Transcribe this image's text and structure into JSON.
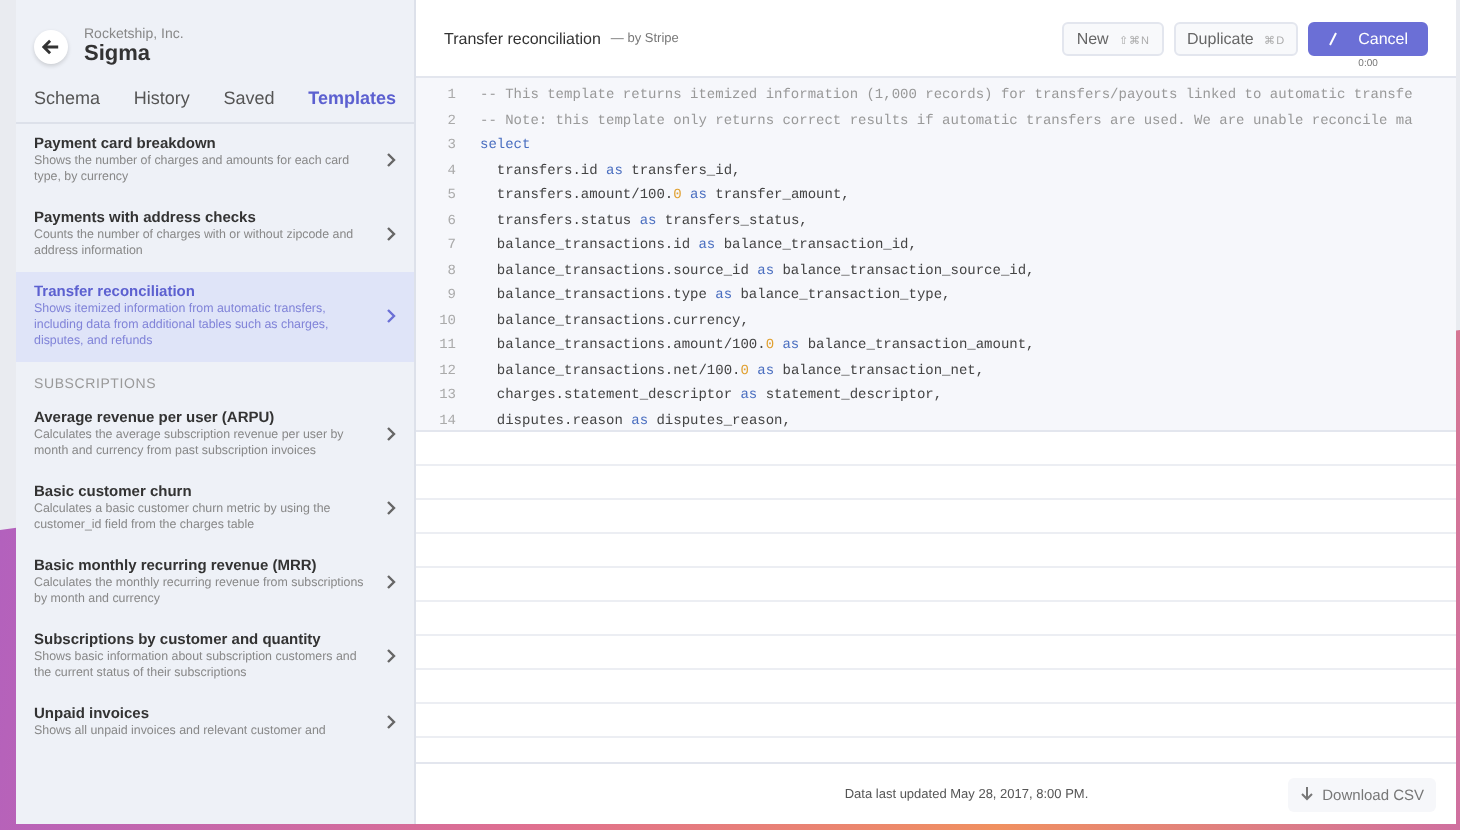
{
  "sidebar": {
    "account": "Rocketship, Inc.",
    "app_title": "Sigma",
    "tabs": [
      {
        "label": "Schema",
        "selected": false
      },
      {
        "label": "History",
        "selected": false
      },
      {
        "label": "Saved",
        "selected": false
      },
      {
        "label": "Templates",
        "selected": true
      }
    ],
    "groups": [
      {
        "items": [
          {
            "title": "Payment card breakdown",
            "description": "Shows the number of charges and amounts for each card type, by currency",
            "selected": false
          },
          {
            "title": "Payments with address checks",
            "description": "Counts the number of charges with or without zipcode and address information",
            "selected": false
          },
          {
            "title": "Transfer reconciliation",
            "description": "Shows itemized information from automatic transfers, including data from additional tables such as charges, disputes, and refunds",
            "selected": true
          }
        ]
      },
      {
        "heading": "SUBSCRIPTIONS",
        "items": [
          {
            "title": "Average revenue per user (ARPU)",
            "description": "Calculates the average subscription revenue per user by month and currency from past subscription invoices",
            "selected": false
          },
          {
            "title": "Basic customer churn",
            "description": "Calculates a basic customer churn metric by using the customer_id field from the charges table",
            "selected": false
          },
          {
            "title": "Basic monthly recurring revenue (MRR)",
            "description": "Calculates the monthly recurring revenue from subscriptions by month and currency",
            "selected": false
          },
          {
            "title": "Subscriptions by customer and quantity",
            "description": "Shows basic information about subscription customers and the current status of their subscriptions",
            "selected": false
          },
          {
            "title": "Unpaid invoices",
            "description": "Shows all unpaid invoices and relevant customer and",
            "selected": false
          }
        ]
      }
    ]
  },
  "header": {
    "title": "Transfer reconciliation",
    "byline": "— by Stripe",
    "buttons": [
      {
        "kind": "plain",
        "label": "New",
        "shortcut": "⇧⌘N"
      },
      {
        "kind": "plain",
        "label": "Duplicate",
        "shortcut": "⌘D"
      },
      {
        "kind": "primary",
        "label": "Cancel",
        "timer": "0:00"
      }
    ]
  },
  "editor": {
    "lines": [
      {
        "number": "1",
        "tokens": [
          {
            "kind": "comment",
            "text": "-- This template returns itemized information (1,000 records) for transfers/payouts linked to automatic transfe"
          }
        ]
      },
      {
        "number": "2",
        "tokens": [
          {
            "kind": "comment",
            "text": "-- Note: this template only returns correct results if automatic transfers are used. We are unable reconcile ma"
          }
        ]
      },
      {
        "number": "3",
        "tokens": [
          {
            "kind": "keyword",
            "text": "select"
          }
        ]
      },
      {
        "number": "4",
        "tokens": [
          {
            "kind": "plain",
            "text": "  transfers.id "
          },
          {
            "kind": "keyword",
            "text": "as"
          },
          {
            "kind": "plain",
            "text": " transfers_id,"
          }
        ]
      },
      {
        "number": "5",
        "tokens": [
          {
            "kind": "plain",
            "text": "  transfers.amount/100."
          },
          {
            "kind": "number",
            "text": "0 "
          },
          {
            "kind": "keyword",
            "text": "as"
          },
          {
            "kind": "plain",
            "text": " transfer_amount,"
          }
        ]
      },
      {
        "number": "6",
        "tokens": [
          {
            "kind": "plain",
            "text": "  transfers.status "
          },
          {
            "kind": "keyword",
            "text": "as"
          },
          {
            "kind": "plain",
            "text": " transfers_status,"
          }
        ]
      },
      {
        "number": "7",
        "tokens": [
          {
            "kind": "plain",
            "text": "  balance_transactions.id "
          },
          {
            "kind": "keyword",
            "text": "as"
          },
          {
            "kind": "plain",
            "text": " balance_transaction_id,"
          }
        ]
      },
      {
        "number": "8",
        "tokens": [
          {
            "kind": "plain",
            "text": "  balance_transactions.source_id "
          },
          {
            "kind": "keyword",
            "text": "as"
          },
          {
            "kind": "plain",
            "text": " balance_transaction_source_id,"
          }
        ]
      },
      {
        "number": "9",
        "tokens": [
          {
            "kind": "plain",
            "text": "  balance_transactions.type "
          },
          {
            "kind": "keyword",
            "text": "as"
          },
          {
            "kind": "plain",
            "text": " balance_transaction_type,"
          }
        ]
      },
      {
        "number": "10",
        "tokens": [
          {
            "kind": "plain",
            "text": "  balance_transactions.currency,"
          }
        ]
      },
      {
        "number": "11",
        "tokens": [
          {
            "kind": "plain",
            "text": "  balance_transactions.amount/100."
          },
          {
            "kind": "number",
            "text": "0 "
          },
          {
            "kind": "keyword",
            "text": "as"
          },
          {
            "kind": "plain",
            "text": " balance_transaction_amount,"
          }
        ]
      },
      {
        "number": "12",
        "tokens": [
          {
            "kind": "plain",
            "text": "  balance_transactions.net/100."
          },
          {
            "kind": "number",
            "text": "0 "
          },
          {
            "kind": "keyword",
            "text": "as"
          },
          {
            "kind": "plain",
            "text": " balance_transaction_net,"
          }
        ]
      },
      {
        "number": "13",
        "tokens": [
          {
            "kind": "plain",
            "text": "  charges.statement_descriptor "
          },
          {
            "kind": "keyword",
            "text": "as"
          },
          {
            "kind": "plain",
            "text": " statement_descriptor,"
          }
        ]
      },
      {
        "number": "14",
        "tokens": [
          {
            "kind": "plain",
            "text": "  disputes.reason "
          },
          {
            "kind": "keyword",
            "text": "as"
          },
          {
            "kind": "plain",
            "text": " disputes_reason,"
          }
        ]
      }
    ]
  },
  "footer": {
    "status": "Data last updated May 28, 2017, 8:00 PM.",
    "download": "Download CSV"
  }
}
